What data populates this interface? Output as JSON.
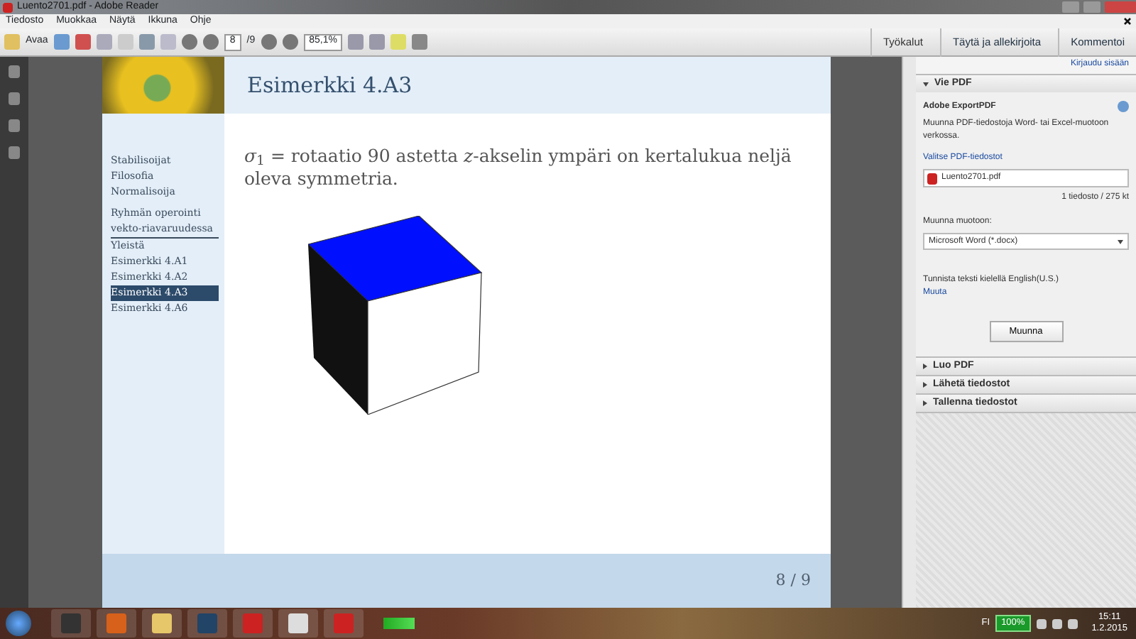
{
  "window": {
    "title": "Luento2701.pdf - Adobe Reader"
  },
  "menu": [
    "Tiedosto",
    "Muokkaa",
    "Näytä",
    "Ikkuna",
    "Ohje"
  ],
  "toolbar": {
    "open_label": "Avaa",
    "page": "8",
    "page_total": "/9",
    "zoom": "85,1%",
    "tabs": [
      "Työkalut",
      "Täytä ja allekirjoita",
      "Kommentoi"
    ]
  },
  "slide": {
    "title": "Esimerkki 4.A3",
    "nav": [
      {
        "label": "Stabilisoijat",
        "kind": "link",
        "selected": false
      },
      {
        "label": "Filosofia",
        "kind": "link",
        "selected": false
      },
      {
        "label": "Normalisoija",
        "kind": "link",
        "selected": false
      },
      {
        "label": "Ryhmän operointi vekto-riavaruudessa",
        "kind": "section",
        "selected": false
      },
      {
        "label": "Yleistä",
        "kind": "link",
        "selected": false
      },
      {
        "label": "Esimerkki 4.A1",
        "kind": "link",
        "selected": false
      },
      {
        "label": "Esimerkki 4.A2",
        "kind": "link",
        "selected": false
      },
      {
        "label": "Esimerkki 4.A3",
        "kind": "link",
        "selected": true
      },
      {
        "label": "Esimerkki 4.A6",
        "kind": "link",
        "selected": false
      }
    ],
    "text": "*σ*$_{1}$ = rotaatio 90 astetta *z*-akselin ympäri on kertalukua neljä oleva symmetria.",
    "footer": "8 / 9"
  },
  "pane": {
    "login": "Kirjaudu sisään",
    "sections": [
      {
        "title": "Vie PDF",
        "expanded": true
      },
      {
        "title": "Luo PDF",
        "expanded": false
      },
      {
        "title": "Lähetä tiedostot",
        "expanded": false
      },
      {
        "title": "Tallenna tiedostot",
        "expanded": false
      }
    ],
    "export": {
      "heading": "Adobe ExportPDF",
      "description": "Muunna PDF-tiedostoja Word- tai Excel-muotoon verkossa.",
      "choose": "Valitse PDF-tiedostot",
      "file": "Luento2701.pdf",
      "size": "1 tiedosto / 275 kt",
      "format_label": "Muunna muotoon:",
      "format": "Microsoft Word (*.docx)",
      "language": "Tunnista teksti kielellä English(U.S.)",
      "change": "Muuta",
      "button": "Muunna"
    }
  },
  "taskbar": {
    "language": "FI",
    "battery": "100%",
    "time": "15:11",
    "date": "1.2.2015"
  }
}
